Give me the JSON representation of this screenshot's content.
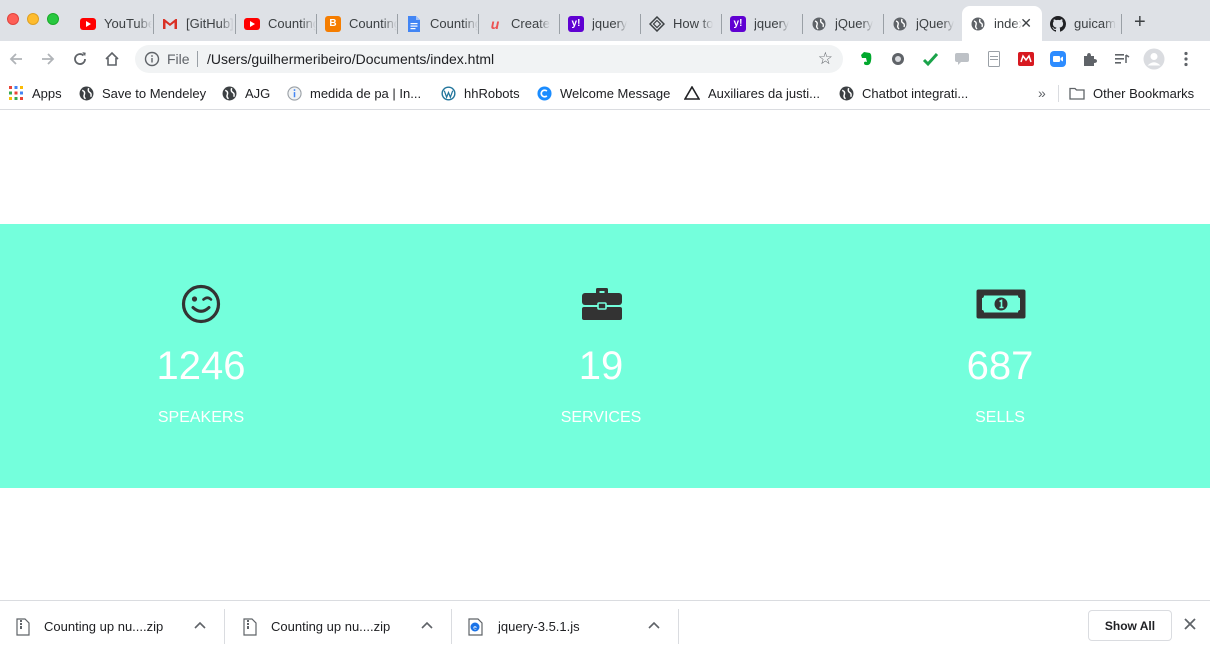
{
  "tabs": [
    {
      "title": "YouTube",
      "icon": "youtube-icon",
      "color": "#ff0000"
    },
    {
      "title": "[GitHub]",
      "icon": "gmail-icon",
      "color": "#d93025"
    },
    {
      "title": "Counting",
      "icon": "youtube-icon",
      "color": "#ff0000"
    },
    {
      "title": "Counting",
      "icon": "blogger-icon",
      "color": "#f57d00"
    },
    {
      "title": "Counting",
      "icon": "docs-icon",
      "color": "#4285f4"
    },
    {
      "title": "Create",
      "icon": "udemy-icon",
      "color": "#ec5252"
    },
    {
      "title": "jquery",
      "icon": "yahoo-icon",
      "color": "#6001d2"
    },
    {
      "title": "How to",
      "icon": "diamond-icon",
      "color": "#3c4043"
    },
    {
      "title": "jquery",
      "icon": "yahoo-icon",
      "color": "#6001d2"
    },
    {
      "title": "jQuery",
      "icon": "globe-icon",
      "color": "#5f6368"
    },
    {
      "title": "jQuery",
      "icon": "globe-icon",
      "color": "#5f6368"
    },
    {
      "title": "index",
      "icon": "globe-icon",
      "color": "#5f6368",
      "active": true
    },
    {
      "title": "guicam",
      "icon": "github-icon",
      "color": "#202124"
    }
  ],
  "omnibox": {
    "scheme": "File",
    "url": "/Users/guilhermeribeiro/Documents/index.html"
  },
  "bookmarks": [
    {
      "label": "Apps",
      "icon": "apps-grid-icon"
    },
    {
      "label": "Save to Mendeley",
      "icon": "globe-icon"
    },
    {
      "label": "AJG",
      "icon": "globe-icon"
    },
    {
      "label": "medida de pa | In...",
      "icon": "info-icon"
    },
    {
      "label": "hhRobots",
      "icon": "wordpress-icon"
    },
    {
      "label": "Welcome Message",
      "icon": "c-icon"
    },
    {
      "label": "Auxiliares da justi...",
      "icon": "triangle-icon"
    },
    {
      "label": "Chatbot integrati...",
      "icon": "globe-icon"
    }
  ],
  "bookmarks_overflow": "»",
  "other_bookmarks": "Other Bookmarks",
  "counters": [
    {
      "value": "1246",
      "label": "SPEAKERS",
      "icon": "wink-smile-icon"
    },
    {
      "value": "19",
      "label": "SERVICES",
      "icon": "briefcase-icon"
    },
    {
      "value": "687",
      "label": "SELLS",
      "icon": "money-bill-icon"
    }
  ],
  "theme": {
    "band_color": "#74ffdc",
    "icon_color": "#333333",
    "text_color": "#ffffff"
  },
  "downloads": [
    {
      "name": "Counting up nu....zip",
      "icon": "zip-file-icon"
    },
    {
      "name": "Counting up nu....zip",
      "icon": "zip-file-icon"
    },
    {
      "name": "jquery-3.5.1.js",
      "icon": "js-file-icon"
    }
  ],
  "downloads_show_all": "Show All"
}
